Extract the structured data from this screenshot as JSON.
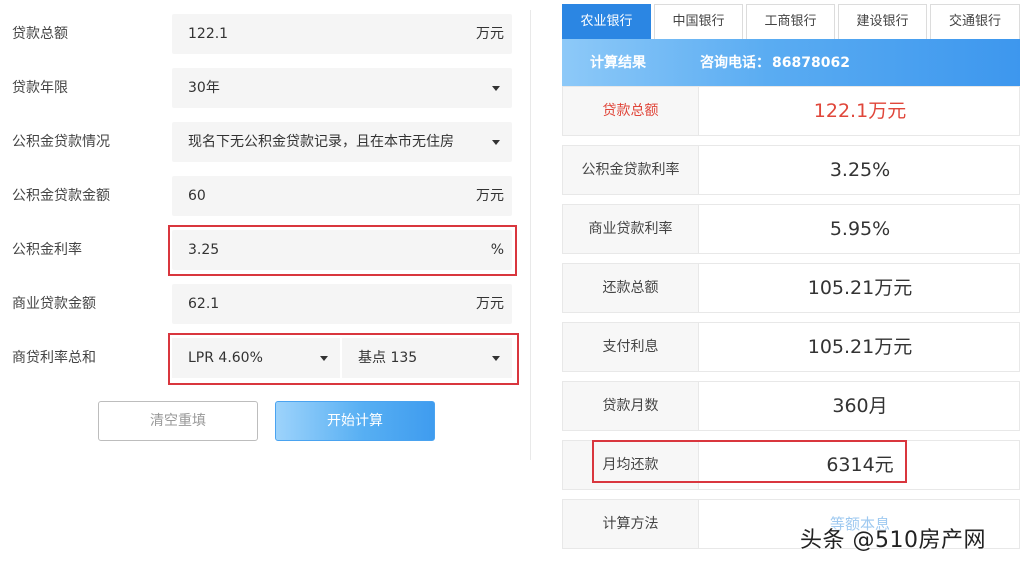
{
  "form": {
    "loan_total": {
      "label": "贷款总额",
      "value": "122.1",
      "unit": "万元"
    },
    "loan_term": {
      "label": "贷款年限",
      "value": "30年"
    },
    "fund_situation": {
      "label": "公积金贷款情况",
      "value": "现名下无公积金贷款记录，且在本市无住房"
    },
    "fund_amount": {
      "label": "公积金贷款金额",
      "value": "60",
      "unit": "万元"
    },
    "fund_rate": {
      "label": "公积金利率",
      "value": "3.25",
      "unit": "%"
    },
    "commercial_amount": {
      "label": "商业贷款金额",
      "value": "62.1",
      "unit": "万元"
    },
    "commercial_rate": {
      "label": "商贷利率总和",
      "lpr": "LPR 4.60%",
      "basis": "基点 135"
    },
    "reset_label": "清空重填",
    "calc_label": "开始计算"
  },
  "panel": {
    "tabs": [
      {
        "label": "农业银行",
        "active": true
      },
      {
        "label": "中国银行",
        "active": false
      },
      {
        "label": "工商银行",
        "active": false
      },
      {
        "label": "建设银行",
        "active": false
      },
      {
        "label": "交通银行",
        "active": false
      }
    ],
    "header_title": "计算结果",
    "hotline_label": "咨询电话：",
    "hotline_number": "86878062",
    "rows": [
      {
        "label": "贷款总额",
        "value": "122.1万元"
      },
      {
        "label": "公积金贷款利率",
        "value": "3.25%"
      },
      {
        "label": "商业贷款利率",
        "value": "5.95%"
      },
      {
        "label": "还款总额",
        "value": "105.21万元"
      },
      {
        "label": "支付利息",
        "value": "105.21万元"
      },
      {
        "label": "贷款月数",
        "value": "360月"
      },
      {
        "label": "月均还款",
        "value": "6314元"
      },
      {
        "label": "计算方法",
        "value": "等额本息"
      }
    ]
  },
  "watermark": "头条 @510房产网",
  "colors": {
    "accent": "#2b86e3",
    "highlight_box": "#d9363e",
    "result_red": "#e0463a"
  }
}
